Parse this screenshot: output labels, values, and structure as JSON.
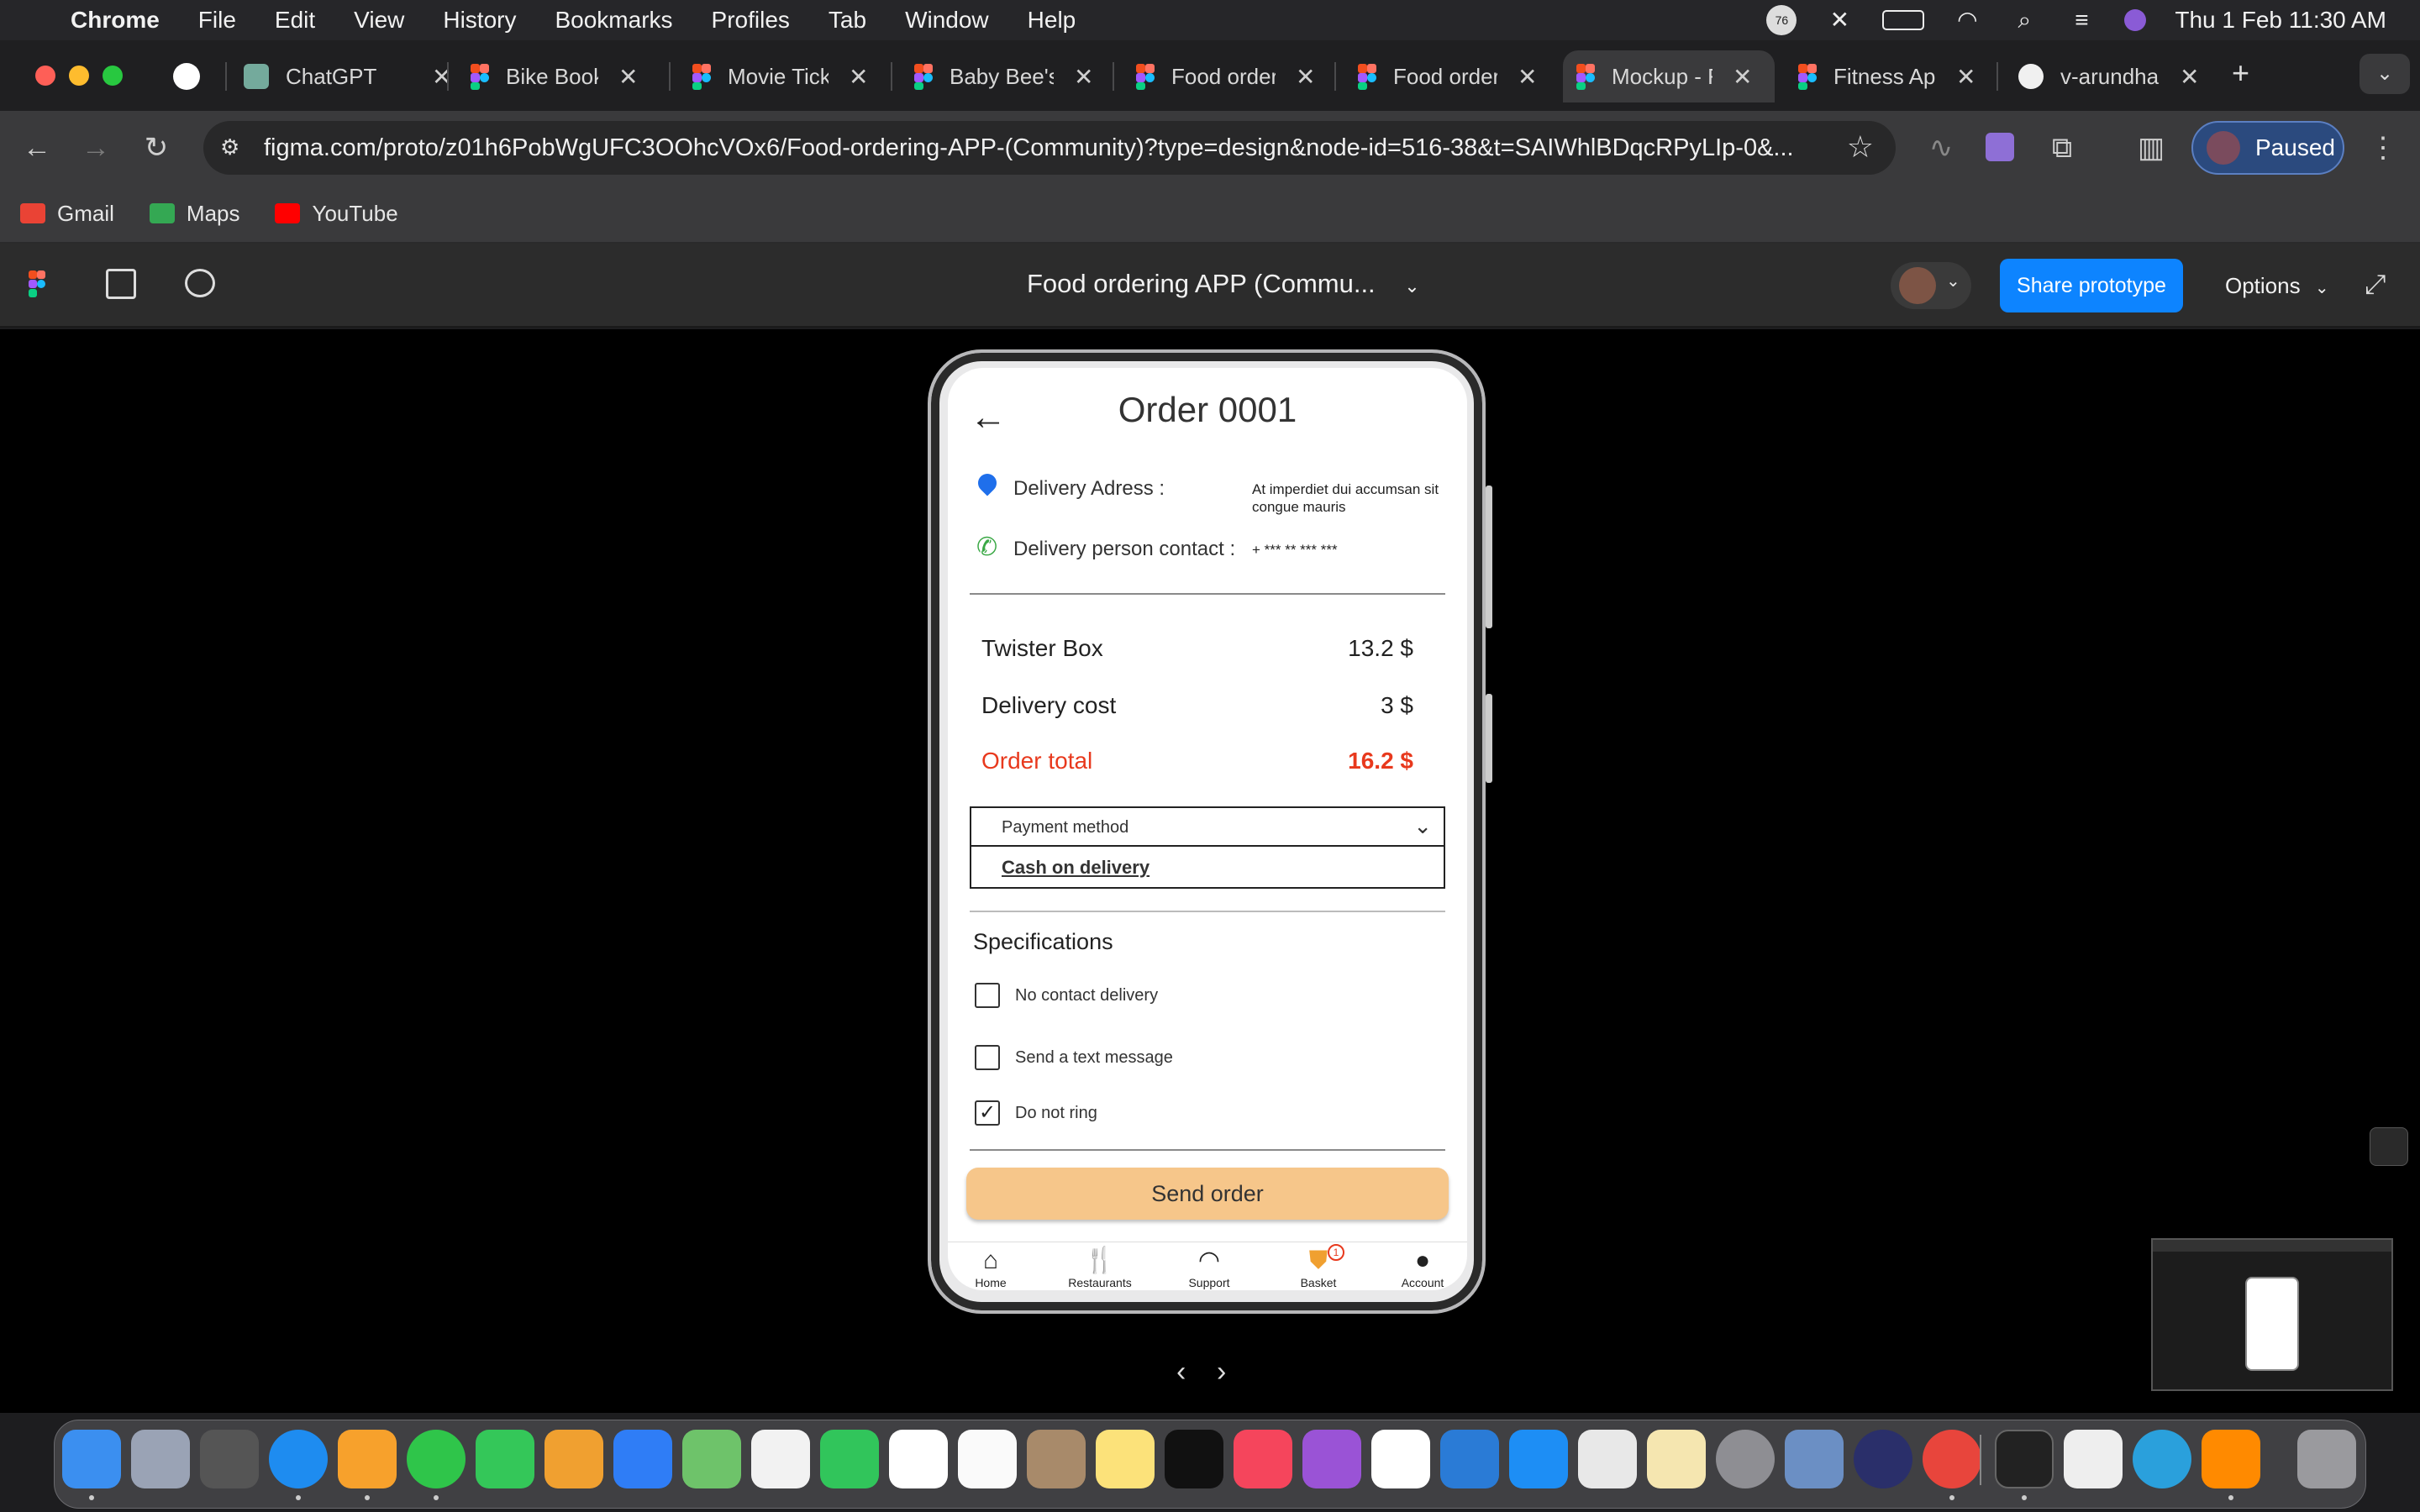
{
  "menubar": {
    "app": "Chrome",
    "items": [
      "File",
      "Edit",
      "View",
      "History",
      "Bookmarks",
      "Profiles",
      "Tab",
      "Window",
      "Help"
    ],
    "badge": "76",
    "datetime": "Thu 1 Feb  11:30 AM"
  },
  "tabs": [
    {
      "title": "",
      "icon": "app-icon"
    },
    {
      "title": "ChatGPT",
      "icon": "chatgpt-icon"
    },
    {
      "title": "Bike Booking",
      "icon": "figma-icon"
    },
    {
      "title": "Movie Ticket",
      "icon": "figma-icon"
    },
    {
      "title": "Baby Bee's",
      "icon": "figma-icon"
    },
    {
      "title": "Food order",
      "icon": "figma-icon"
    },
    {
      "title": "Food order",
      "icon": "figma-icon"
    },
    {
      "title": "Mockup - F",
      "icon": "figma-icon"
    },
    {
      "title": "Fitness Ap",
      "icon": "figma-icon"
    },
    {
      "title": "v-arundha",
      "icon": "github-icon"
    }
  ],
  "address": {
    "url": "figma.com/proto/z01h6PobWgUFC3OOhcVOx6/Food-ordering-APP-(Community)?type=design&node-id=516-38&t=SAIWhlBDqcRPyLIp-0&..."
  },
  "profile": {
    "label": "Paused"
  },
  "bookmarks": [
    {
      "label": "Gmail",
      "color": "#ea4335"
    },
    {
      "label": "Maps",
      "color": "#34a853"
    },
    {
      "label": "YouTube",
      "color": "#ff0000"
    }
  ],
  "figma": {
    "file_title": "Food ordering APP (Commu...",
    "share_label": "Share prototype",
    "options_label": "Options"
  },
  "screen": {
    "title": "Order 0001",
    "address_label": "Delivery Adress :",
    "address_value": "At imperdiet dui accumsan sit congue mauris",
    "contact_label": "Delivery person contact :",
    "contact_value": "+ *** ** *** ***",
    "items": [
      {
        "name": "Twister Box",
        "price": "13.2 $"
      },
      {
        "name": "Delivery cost",
        "price": "3 $"
      }
    ],
    "total_label": "Order total",
    "total_value": "16.2 $",
    "payment_placeholder": "Payment method",
    "payment_option": "Cash on delivery",
    "specs_title": "Specifications",
    "specs": [
      {
        "label": "No contact delivery",
        "checked": false
      },
      {
        "label": "Send a text message",
        "checked": false
      },
      {
        "label": "Do not ring",
        "checked": true
      }
    ],
    "send_label": "Send order",
    "nav": [
      {
        "label": "Home",
        "icon": "home-icon"
      },
      {
        "label": "Restaurants",
        "icon": "fork-knife-icon"
      },
      {
        "label": "Support",
        "icon": "headset-icon"
      },
      {
        "label": "Basket",
        "icon": "basket-icon",
        "badge": "1"
      },
      {
        "label": "Account",
        "icon": "account-icon"
      }
    ]
  },
  "colors": {
    "accent": "#0d84ff",
    "total_red": "#e8391d",
    "send_button": "#f6c68a",
    "pin_blue": "#1f6feb",
    "phone_green": "#3aa845"
  }
}
